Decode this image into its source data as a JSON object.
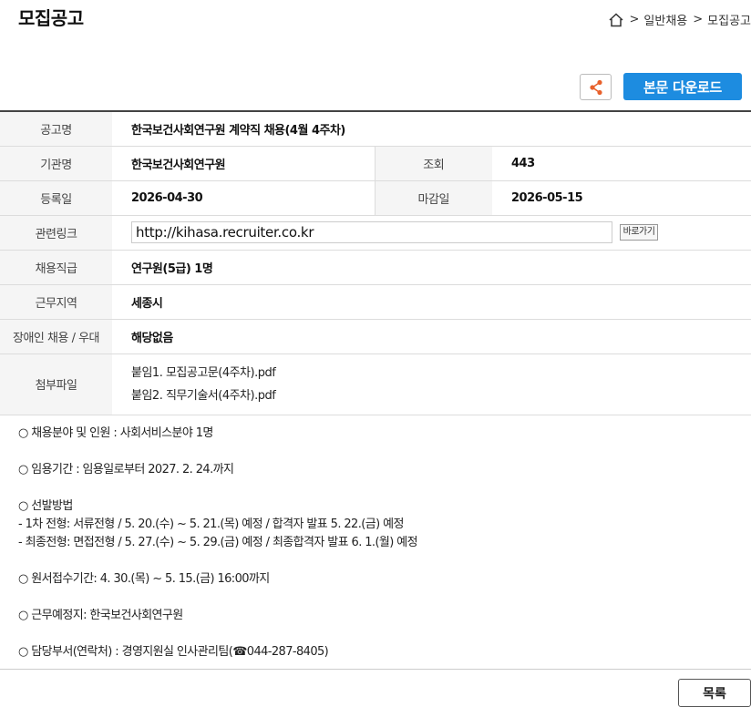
{
  "header": {
    "title": "모집공고",
    "breadcrumb": [
      ">",
      "일반채용",
      ">",
      "모집공고"
    ]
  },
  "actions": {
    "download_label": "본문 다운로드"
  },
  "info": {
    "title_label": "공고명",
    "title_value": "한국보건사회연구원 계약직 채용(4월 4주차)",
    "org_label": "기관명",
    "org_value": "한국보건사회연구원",
    "views_label": "조회",
    "views_value": "443",
    "reg_label": "등록일",
    "reg_value": "2026-04-30",
    "deadline_label": "마감일",
    "deadline_value": "2026-05-15",
    "link_label": "관련링크",
    "link_value": "http://kihasa.recruiter.co.kr",
    "link_go": "바로가기",
    "position_label": "채용직급",
    "position_value": "연구원(5급) 1명",
    "region_label": "근무지역",
    "region_value": "세종시",
    "disability_label": "장애인 채용 / 우대",
    "disability_value": "해당없음",
    "files_label": "첨부파일",
    "files": [
      "붙임1. 모집공고문(4주차).pdf",
      "붙임2. 직무기술서(4주차).pdf"
    ]
  },
  "body": {
    "lines": [
      "○ 채용분야 및 인원 :  사회서비스분야 1명",
      "",
      "○ 임용기간 : 임용일로부터 2027. 2. 24.까지",
      "",
      "○ 선발방법",
      " - 1차 전형: 서류전형 / 5. 20.(수) ~ 5. 21.(목) 예정 / 합격자 발표 5. 22.(금) 예정",
      " - 최종전형: 면접전형 / 5. 27.(수) ~ 5. 29.(금) 예정 / 최종합격자 발표 6. 1.(월) 예정",
      "",
      "○ 원서접수기간: 4. 30.(목) ~ 5. 15.(금) 16:00까지",
      "",
      "○ 근무예정지: 한국보건사회연구원",
      "",
      "○ 담당부서(연락처) : 경영지원실 인사관리팀(☎044-287-8405)"
    ]
  },
  "footer": {
    "list_label": "목록"
  }
}
